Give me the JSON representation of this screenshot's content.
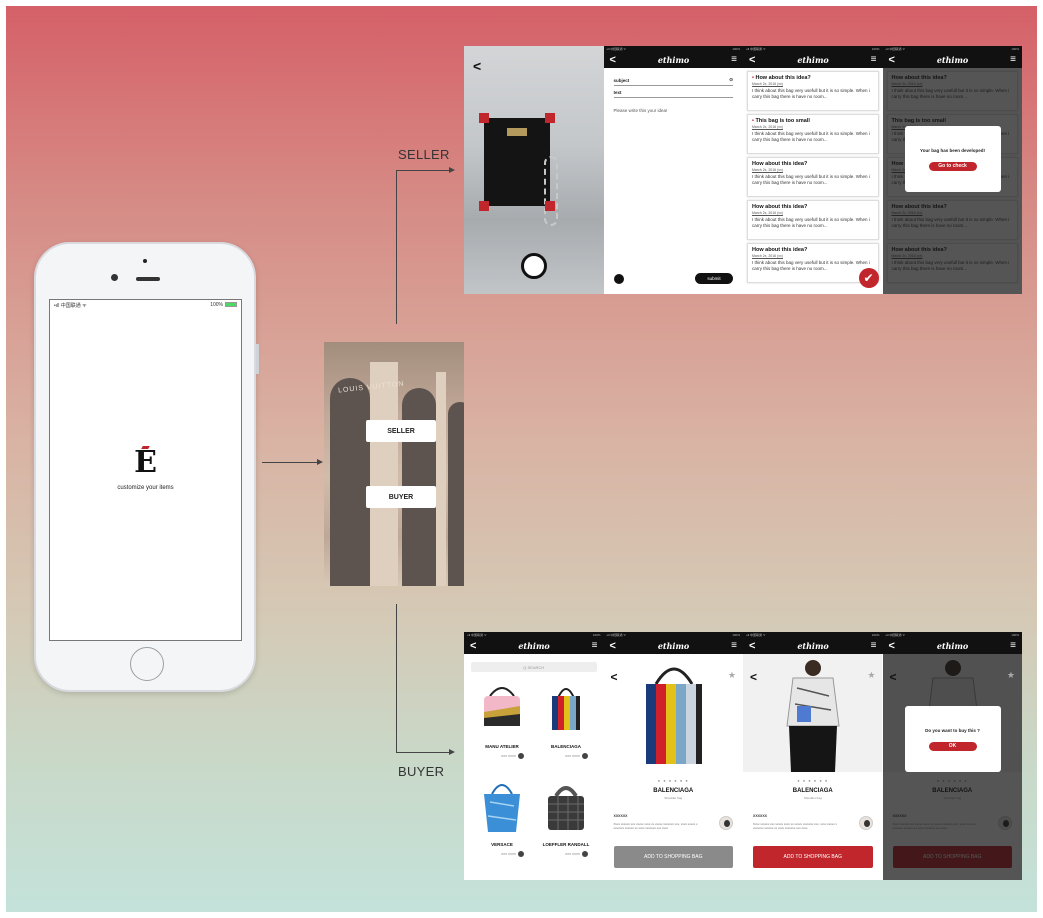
{
  "flow": {
    "seller_label": "SELLER",
    "buyer_label": "BUYER"
  },
  "splash": {
    "status_left": "•ıll 中国联通 ᯤ",
    "status_right": "100%",
    "logo_letter": "E",
    "tagline": "customize your items"
  },
  "choice": {
    "sign_text": "LOUIS VUITTON",
    "seller_button": "SELLER",
    "buyer_button": "BUYER"
  },
  "app": {
    "brand": "ethimo",
    "back_glyph": "<",
    "menu_glyph": "≡",
    "status_left": "•ıll 中国联通 ᯤ",
    "status_right": "100%"
  },
  "seller": {
    "camera_back": "<",
    "form": {
      "subject_label": "subject",
      "text_label": "text",
      "hint": "Please write this your idea!",
      "submit_label": "submit"
    },
    "ideas": [
      {
        "title": "How about this idea?",
        "date": "March 2x, 2016 (xx)",
        "body": "I think about this bag very usefull but it is so simple. When i carry this bag there is have no room...",
        "highlight": true
      },
      {
        "title": "This bag is too small",
        "date": "March 2x, 2016 (xx)",
        "body": "I think about this bag very usefull but it is so simple. When i carry this bag there is have no room...",
        "highlight": true
      },
      {
        "title": "How about this idea?",
        "date": "March 2x, 2016 (xx)",
        "body": "I think about this bag very usefull but it is so simple. When i carry this bag there is have no room...",
        "highlight": false
      },
      {
        "title": "How about this idea?",
        "date": "March 2x, 2016 (xx)",
        "body": "I think about this bag very usefull but it is so simple. When i carry this bag there is have no room...",
        "highlight": false
      },
      {
        "title": "How about this idea?",
        "date": "March 2x, 2016 (xx)",
        "body": "I think about this bag very usefull but it is so simple. When i carry this bag there is have no room...",
        "highlight": false
      }
    ],
    "dialog": {
      "message": "Your bag has been developed!",
      "button": "Go to check"
    }
  },
  "buyer": {
    "search_placeholder": "Q  SEARCH",
    "products": [
      {
        "name": "MANU ATELIER",
        "meta": "XXX XXXX"
      },
      {
        "name": "BALENCIAGA",
        "meta": "XXX XXXX"
      },
      {
        "name": "VERSACE",
        "meta": "XXX XXXX"
      },
      {
        "name": "LOEFFLER RANDALL",
        "meta": "XXX XXXX"
      }
    ],
    "detail": {
      "back": "<",
      "star": "★",
      "dots": "● ● ● ● ● ●",
      "name": "BALENCIAGA",
      "subtitle": "Shoulder bag",
      "desc_heading": "XXXXXX",
      "desc": "Xxxx xxxxxx xxx xxxxx xxxx xx xxxxx xxxxxxx xxx, xxxx xxxxx x xxxxxxx xxxxxx xx xxxx xxxxxxx xxx xxxx",
      "cta": "ADD TO SHOPPING BAG"
    },
    "dialog": {
      "message": "Do you want to buy this ?",
      "button": "OK"
    }
  },
  "colors": {
    "accent_red": "#c0262c",
    "dark": "#111111",
    "cta_grey": "#8a8a8a"
  }
}
